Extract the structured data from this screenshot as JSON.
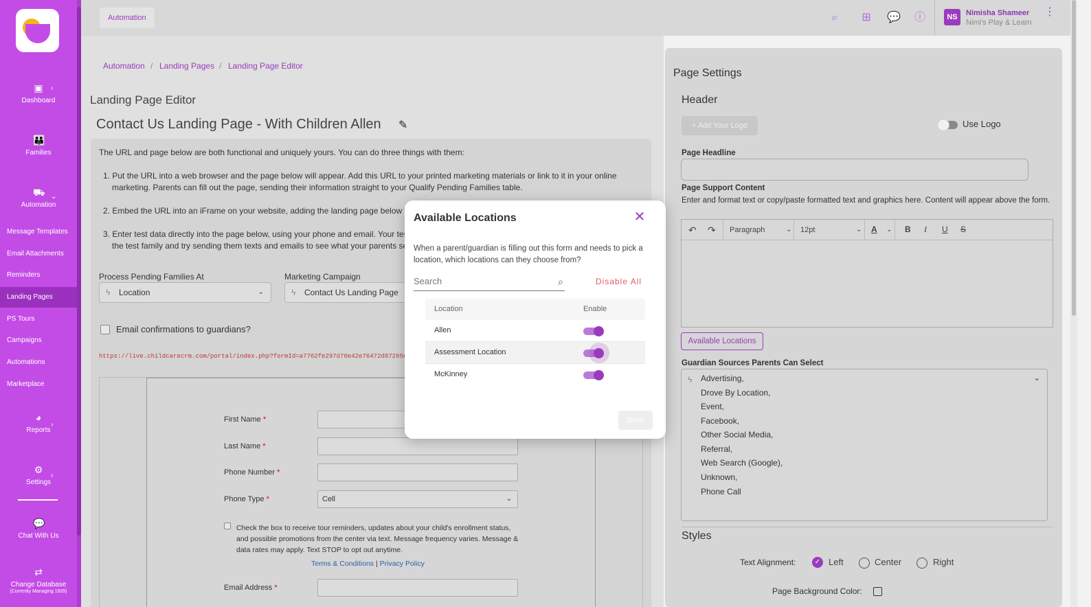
{
  "sidebar": {
    "nav_big": [
      {
        "label": "Dashboard",
        "icon": "dashboard-icon"
      },
      {
        "label": "Families",
        "icon": "families-icon"
      },
      {
        "label": "Automation",
        "icon": "automation-icon"
      },
      {
        "label": "Reports",
        "icon": "reports-icon"
      },
      {
        "label": "Settings",
        "icon": "gear-icon"
      },
      {
        "label": "Chat With Us",
        "icon": "chat-icon"
      },
      {
        "label": "Change Database",
        "icon": "swap-icon"
      }
    ],
    "change_db_sub": "(Currently Managing 1935)",
    "sub_items": [
      {
        "label": "Message Templates"
      },
      {
        "label": "Email Attachments"
      },
      {
        "label": "Reminders"
      },
      {
        "label": "Landing Pages",
        "active": true
      },
      {
        "label": "PS Tours"
      },
      {
        "label": "Campaigns"
      },
      {
        "label": "Automations"
      },
      {
        "label": "Marketplace"
      }
    ],
    "accent": "#c44ce6"
  },
  "topbar": {
    "chip": "Automation",
    "avatar": "NS",
    "user_name": "Nimisha Shameer",
    "user_org": "Nimi's Play & Learn"
  },
  "breadcrumb": [
    "Automation",
    "Landing Pages",
    "Landing Page Editor"
  ],
  "main": {
    "page_title": "Landing Page Editor",
    "lp_title": "Contact Us Landing Page - With Children Allen",
    "intro": "The URL and page below are both functional and uniquely yours. You can do three things with them:",
    "steps": [
      {
        "a": "1.  Put the URL into a web browser and the page below will appear. Add this URL to your printed marketing materials or link to it in your online",
        "b": "marketing. Parents can fill out the page, sending their information straight to your Qualify Pending Families table."
      },
      {
        "a": "2.  Embed the URL into an iFrame on your website, adding the landing page below to"
      },
      {
        "a": "3.  Enter test data directly into the page below, using your phone and email. Your tes",
        "b": "the test family and try sending them texts and emails to see what your parents se"
      }
    ],
    "process_label": "Process Pending Families At",
    "process_value": "Location",
    "campaign_label": "Marketing Campaign",
    "campaign_value": "Contact Us Landing Page",
    "email_confirm": "Email confirmations to guardians?",
    "url": "https://live.childcarecrm.com/portal/index.php?formId=a7762fe297d70e42e76472d87265e68",
    "form": {
      "first_name": "First Name",
      "last_name": "Last Name",
      "phone_number": "Phone Number",
      "phone_type": "Phone Type",
      "phone_type_value": "Cell",
      "consent": "Check the box to receive tour reminders, updates about your child's enrollment status, and possible promotions from the center via text. Message frequency varies. Message & data rates may apply. Text STOP to opt out anytime.",
      "terms": "Terms & Conditions",
      "link_sep": "|",
      "privacy": "Privacy Policy",
      "email": "Email Address",
      "req": "*"
    }
  },
  "settings": {
    "title": "Page Settings",
    "header": "Header",
    "add_logo": "Add Your Logo",
    "use_logo": "Use Logo",
    "headline_label": "Page Headline",
    "support_label": "Page Support Content",
    "support_help": "Enter and format text or copy/paste formatted text and graphics here. Content will appear above the form.",
    "toolbar": {
      "paragraph": "Paragraph",
      "size": "12pt",
      "color": "A",
      "bold": "B",
      "italic": "I",
      "underline": "U",
      "strike": "S"
    },
    "available_locations_btn": "Available Locations",
    "sources_label": "Guardian Sources Parents Can Select",
    "sources": [
      "Advertising,",
      "Drove By Location,",
      "Event,",
      "Facebook,",
      "Other Social Media,",
      "Referral,",
      "Web Search (Google),",
      "Unknown,",
      "Phone Call"
    ],
    "styles": "Styles",
    "text_alignment": "Text Alignment:",
    "align_options": [
      "Left",
      "Center",
      "Right"
    ],
    "align_selected": "Left",
    "bg_color": "Page Background Color:"
  },
  "modal": {
    "title": "Available Locations",
    "desc": "When a parent/guardian is filling out this form and needs to pick a location, which locations can they choose from?",
    "search_placeholder": "Search",
    "disable_all": "Disable All",
    "col_location": "Location",
    "col_enable": "Enable",
    "rows": [
      {
        "name": "Allen",
        "enabled": true
      },
      {
        "name": "Assessment Location",
        "enabled": true
      },
      {
        "name": "McKinney",
        "enabled": true
      }
    ],
    "save": "Save"
  }
}
